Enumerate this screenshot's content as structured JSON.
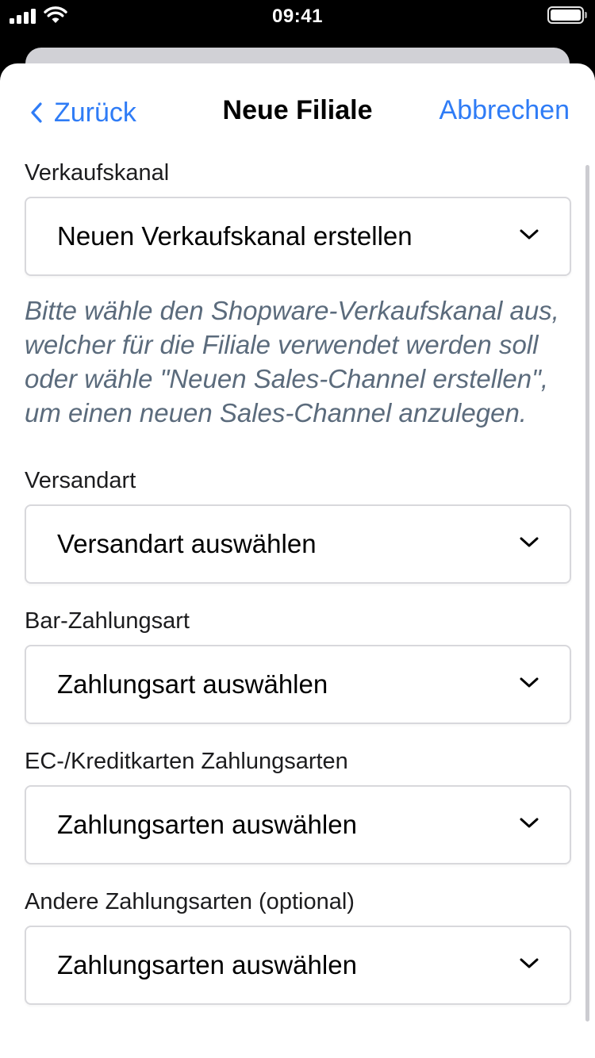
{
  "status_bar": {
    "time": "09:41"
  },
  "navbar": {
    "back_label": "Zurück",
    "title": "Neue Filiale",
    "cancel_label": "Abbrechen"
  },
  "form": {
    "sales_channel": {
      "label": "Verkaufskanal",
      "value": "Neuen Verkaufskanal erstellen",
      "hint": "Bitte wähle den Shopware-Verkaufskanal aus, welcher für die Filiale verwendet werden soll oder wähle \"Neuen Sales-Channel erstellen\", um einen neuen Sales-Channel anzulegen."
    },
    "shipping": {
      "label": "Versandart",
      "value": "Versandart auswählen"
    },
    "cash_payment": {
      "label": "Bar-Zahlungsart",
      "value": "Zahlungsart auswählen"
    },
    "card_payment": {
      "label": "EC-/Kreditkarten Zahlungsarten",
      "value": "Zahlungsarten auswählen"
    },
    "other_payment": {
      "label": "Andere Zahlungsarten (optional)",
      "value": "Zahlungsarten auswählen"
    }
  },
  "colors": {
    "accent": "#2f7cf6",
    "hint_text": "#5b6b7c",
    "border": "#d8d8dc"
  },
  "icons": [
    "signal-icon",
    "wifi-icon",
    "battery-icon",
    "chevron-left-icon",
    "chevron-down-icon"
  ]
}
